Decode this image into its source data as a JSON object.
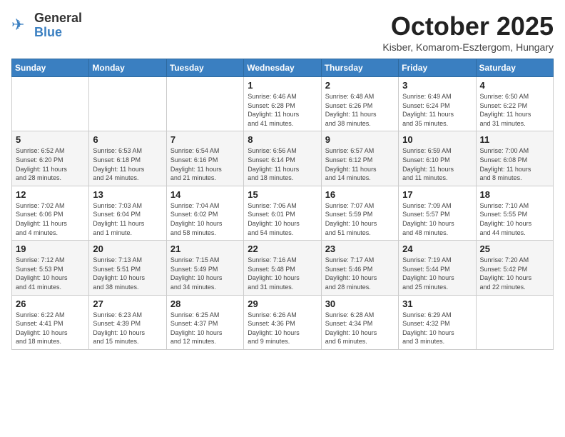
{
  "header": {
    "logo_general": "General",
    "logo_blue": "Blue",
    "month_title": "October 2025",
    "subtitle": "Kisber, Komarom-Esztergom, Hungary"
  },
  "weekdays": [
    "Sunday",
    "Monday",
    "Tuesday",
    "Wednesday",
    "Thursday",
    "Friday",
    "Saturday"
  ],
  "weeks": [
    [
      {
        "day": "",
        "info": ""
      },
      {
        "day": "",
        "info": ""
      },
      {
        "day": "",
        "info": ""
      },
      {
        "day": "1",
        "info": "Sunrise: 6:46 AM\nSunset: 6:28 PM\nDaylight: 11 hours\nand 41 minutes."
      },
      {
        "day": "2",
        "info": "Sunrise: 6:48 AM\nSunset: 6:26 PM\nDaylight: 11 hours\nand 38 minutes."
      },
      {
        "day": "3",
        "info": "Sunrise: 6:49 AM\nSunset: 6:24 PM\nDaylight: 11 hours\nand 35 minutes."
      },
      {
        "day": "4",
        "info": "Sunrise: 6:50 AM\nSunset: 6:22 PM\nDaylight: 11 hours\nand 31 minutes."
      }
    ],
    [
      {
        "day": "5",
        "info": "Sunrise: 6:52 AM\nSunset: 6:20 PM\nDaylight: 11 hours\nand 28 minutes."
      },
      {
        "day": "6",
        "info": "Sunrise: 6:53 AM\nSunset: 6:18 PM\nDaylight: 11 hours\nand 24 minutes."
      },
      {
        "day": "7",
        "info": "Sunrise: 6:54 AM\nSunset: 6:16 PM\nDaylight: 11 hours\nand 21 minutes."
      },
      {
        "day": "8",
        "info": "Sunrise: 6:56 AM\nSunset: 6:14 PM\nDaylight: 11 hours\nand 18 minutes."
      },
      {
        "day": "9",
        "info": "Sunrise: 6:57 AM\nSunset: 6:12 PM\nDaylight: 11 hours\nand 14 minutes."
      },
      {
        "day": "10",
        "info": "Sunrise: 6:59 AM\nSunset: 6:10 PM\nDaylight: 11 hours\nand 11 minutes."
      },
      {
        "day": "11",
        "info": "Sunrise: 7:00 AM\nSunset: 6:08 PM\nDaylight: 11 hours\nand 8 minutes."
      }
    ],
    [
      {
        "day": "12",
        "info": "Sunrise: 7:02 AM\nSunset: 6:06 PM\nDaylight: 11 hours\nand 4 minutes."
      },
      {
        "day": "13",
        "info": "Sunrise: 7:03 AM\nSunset: 6:04 PM\nDaylight: 11 hours\nand 1 minute."
      },
      {
        "day": "14",
        "info": "Sunrise: 7:04 AM\nSunset: 6:02 PM\nDaylight: 10 hours\nand 58 minutes."
      },
      {
        "day": "15",
        "info": "Sunrise: 7:06 AM\nSunset: 6:01 PM\nDaylight: 10 hours\nand 54 minutes."
      },
      {
        "day": "16",
        "info": "Sunrise: 7:07 AM\nSunset: 5:59 PM\nDaylight: 10 hours\nand 51 minutes."
      },
      {
        "day": "17",
        "info": "Sunrise: 7:09 AM\nSunset: 5:57 PM\nDaylight: 10 hours\nand 48 minutes."
      },
      {
        "day": "18",
        "info": "Sunrise: 7:10 AM\nSunset: 5:55 PM\nDaylight: 10 hours\nand 44 minutes."
      }
    ],
    [
      {
        "day": "19",
        "info": "Sunrise: 7:12 AM\nSunset: 5:53 PM\nDaylight: 10 hours\nand 41 minutes."
      },
      {
        "day": "20",
        "info": "Sunrise: 7:13 AM\nSunset: 5:51 PM\nDaylight: 10 hours\nand 38 minutes."
      },
      {
        "day": "21",
        "info": "Sunrise: 7:15 AM\nSunset: 5:49 PM\nDaylight: 10 hours\nand 34 minutes."
      },
      {
        "day": "22",
        "info": "Sunrise: 7:16 AM\nSunset: 5:48 PM\nDaylight: 10 hours\nand 31 minutes."
      },
      {
        "day": "23",
        "info": "Sunrise: 7:17 AM\nSunset: 5:46 PM\nDaylight: 10 hours\nand 28 minutes."
      },
      {
        "day": "24",
        "info": "Sunrise: 7:19 AM\nSunset: 5:44 PM\nDaylight: 10 hours\nand 25 minutes."
      },
      {
        "day": "25",
        "info": "Sunrise: 7:20 AM\nSunset: 5:42 PM\nDaylight: 10 hours\nand 22 minutes."
      }
    ],
    [
      {
        "day": "26",
        "info": "Sunrise: 6:22 AM\nSunset: 4:41 PM\nDaylight: 10 hours\nand 18 minutes."
      },
      {
        "day": "27",
        "info": "Sunrise: 6:23 AM\nSunset: 4:39 PM\nDaylight: 10 hours\nand 15 minutes."
      },
      {
        "day": "28",
        "info": "Sunrise: 6:25 AM\nSunset: 4:37 PM\nDaylight: 10 hours\nand 12 minutes."
      },
      {
        "day": "29",
        "info": "Sunrise: 6:26 AM\nSunset: 4:36 PM\nDaylight: 10 hours\nand 9 minutes."
      },
      {
        "day": "30",
        "info": "Sunrise: 6:28 AM\nSunset: 4:34 PM\nDaylight: 10 hours\nand 6 minutes."
      },
      {
        "day": "31",
        "info": "Sunrise: 6:29 AM\nSunset: 4:32 PM\nDaylight: 10 hours\nand 3 minutes."
      },
      {
        "day": "",
        "info": ""
      }
    ]
  ]
}
